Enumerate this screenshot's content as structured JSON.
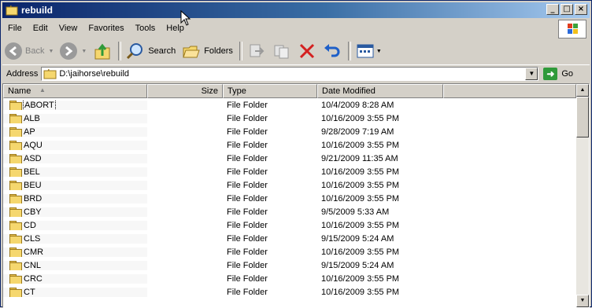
{
  "window": {
    "title": "rebuild",
    "min": "_",
    "max": "□",
    "close": "×"
  },
  "menu": [
    "File",
    "Edit",
    "View",
    "Favorites",
    "Tools",
    "Help"
  ],
  "toolbar": {
    "back": "Back",
    "search": "Search",
    "folders": "Folders"
  },
  "address": {
    "label": "Address",
    "value": "D:\\jaihorse\\rebuild",
    "go": "Go"
  },
  "columns": {
    "name": "Name",
    "size": "Size",
    "type": "Type",
    "date": "Date Modified"
  },
  "rows": [
    {
      "name": "ABORT",
      "size": "",
      "type": "File Folder",
      "date": "10/4/2009 8:28 AM"
    },
    {
      "name": "ALB",
      "size": "",
      "type": "File Folder",
      "date": "10/16/2009 3:55 PM"
    },
    {
      "name": "AP",
      "size": "",
      "type": "File Folder",
      "date": "9/28/2009 7:19 AM"
    },
    {
      "name": "AQU",
      "size": "",
      "type": "File Folder",
      "date": "10/16/2009 3:55 PM"
    },
    {
      "name": "ASD",
      "size": "",
      "type": "File Folder",
      "date": "9/21/2009 11:35 AM"
    },
    {
      "name": "BEL",
      "size": "",
      "type": "File Folder",
      "date": "10/16/2009 3:55 PM"
    },
    {
      "name": "BEU",
      "size": "",
      "type": "File Folder",
      "date": "10/16/2009 3:55 PM"
    },
    {
      "name": "BRD",
      "size": "",
      "type": "File Folder",
      "date": "10/16/2009 3:55 PM"
    },
    {
      "name": "CBY",
      "size": "",
      "type": "File Folder",
      "date": "9/5/2009 5:33 AM"
    },
    {
      "name": "CD",
      "size": "",
      "type": "File Folder",
      "date": "10/16/2009 3:55 PM"
    },
    {
      "name": "CLS",
      "size": "",
      "type": "File Folder",
      "date": "9/15/2009 5:24 AM"
    },
    {
      "name": "CMR",
      "size": "",
      "type": "File Folder",
      "date": "10/16/2009 3:55 PM"
    },
    {
      "name": "CNL",
      "size": "",
      "type": "File Folder",
      "date": "9/15/2009 5:24 AM"
    },
    {
      "name": "CRC",
      "size": "",
      "type": "File Folder",
      "date": "10/16/2009 3:55 PM"
    },
    {
      "name": "CT",
      "size": "",
      "type": "File Folder",
      "date": "10/16/2009 3:55 PM"
    }
  ],
  "colors": {
    "titlebar_start": "#0a246a",
    "titlebar_end": "#a6caf0",
    "chrome": "#d4d0c8",
    "delete_red": "#d42020"
  }
}
